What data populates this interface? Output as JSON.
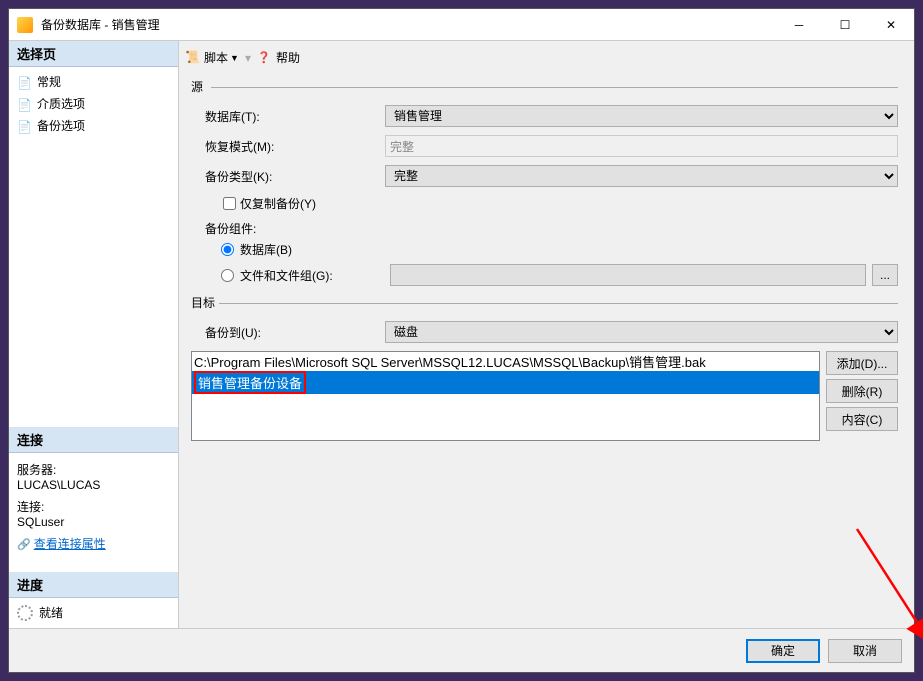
{
  "window": {
    "title": "备份数据库 - 销售管理"
  },
  "sidebar": {
    "select_page_header": "选择页",
    "pages": [
      {
        "label": "常规"
      },
      {
        "label": "介质选项"
      },
      {
        "label": "备份选项"
      }
    ],
    "connection_header": "连接",
    "server_label": "服务器:",
    "server_value": "LUCAS\\LUCAS",
    "conn_label": "连接:",
    "conn_value": "SQLuser",
    "view_conn_props": "查看连接属性",
    "progress_header": "进度",
    "progress_status": "就绪"
  },
  "toolbar": {
    "script": "脚本",
    "help": "帮助"
  },
  "form": {
    "source_group": "源",
    "database_label": "数据库(T):",
    "database_value": "销售管理",
    "recovery_model_label": "恢复模式(M):",
    "recovery_model_value": "完整",
    "backup_type_label": "备份类型(K):",
    "backup_type_value": "完整",
    "copy_only_label": "仅复制备份(Y)",
    "backup_component_label": "备份组件:",
    "radio_db_label": "数据库(B)",
    "radio_files_label": "文件和文件组(G):",
    "dest_group": "目标",
    "backup_to_label": "备份到(U):",
    "backup_to_value": "磁盘",
    "dest_items": [
      "C:\\Program Files\\Microsoft SQL Server\\MSSQL12.LUCAS\\MSSQL\\Backup\\销售管理.bak",
      "销售管理备份设备"
    ],
    "btn_add": "添加(D)...",
    "btn_remove": "删除(R)",
    "btn_contents": "内容(C)"
  },
  "footer": {
    "ok": "确定",
    "cancel": "取消"
  }
}
